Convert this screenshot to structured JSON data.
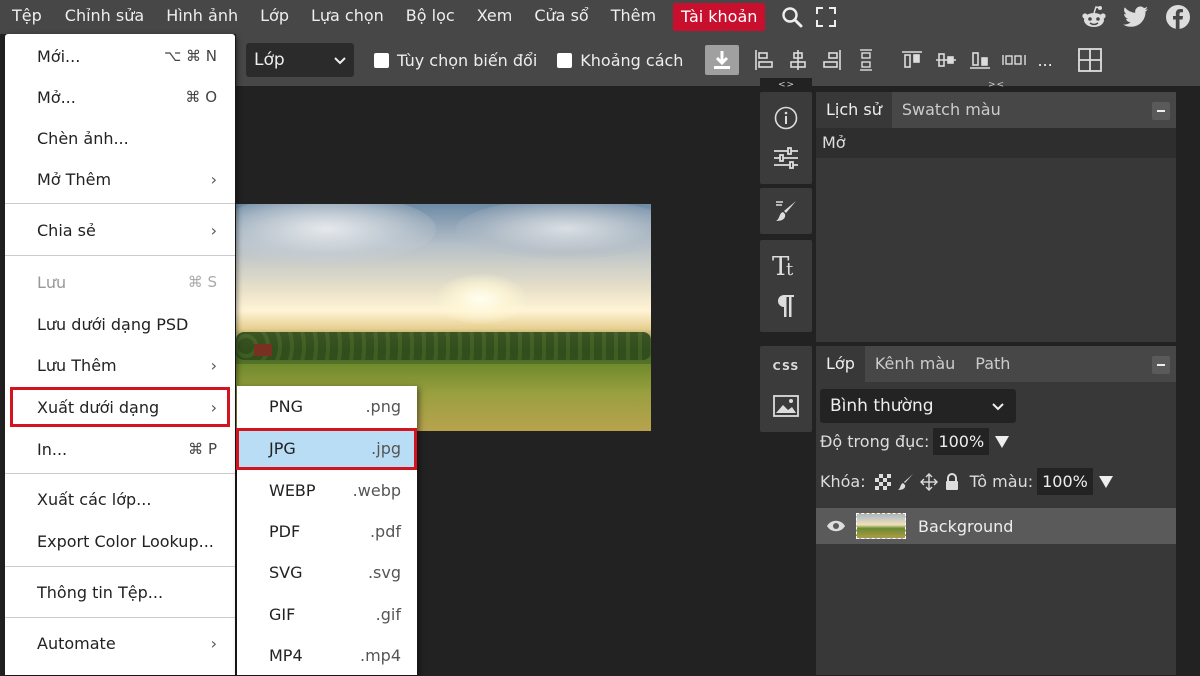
{
  "menubar": {
    "items": [
      "Tệp",
      "Chỉnh sửa",
      "Hình ảnh",
      "Lớp",
      "Lựa chọn",
      "Bộ lọc",
      "Xem",
      "Cửa sổ",
      "Thêm"
    ],
    "account": "Tài khoản",
    "account_color": "#c8102e",
    "icons": [
      "search-icon",
      "fullscreen-icon"
    ],
    "social_icons": [
      "reddit-icon",
      "twitter-icon",
      "facebook-icon"
    ]
  },
  "toolbar": {
    "layer_select": "Lớp",
    "transform_option": "Tùy chọn biến đổi",
    "spacing_option": "Khoảng cách",
    "more": "..."
  },
  "file_menu": {
    "items": [
      {
        "label": "Mới...",
        "shortcut": "⌥ ⌘ N"
      },
      {
        "label": "Mở...",
        "shortcut": "⌘ O"
      },
      {
        "label": "Chèn ảnh...",
        "shortcut": ""
      },
      {
        "label": "Mở Thêm",
        "shortcut": "›"
      },
      {
        "label": "Chia sẻ",
        "shortcut": "›"
      },
      {
        "label": "Lưu",
        "shortcut": "⌘ S",
        "disabled": true
      },
      {
        "label": "Lưu dưới dạng PSD",
        "shortcut": ""
      },
      {
        "label": "Lưu Thêm",
        "shortcut": "›"
      },
      {
        "label": "Xuất dưới dạng",
        "shortcut": "›"
      },
      {
        "label": "In...",
        "shortcut": "⌘ P"
      },
      {
        "label": "Xuất các lớp...",
        "shortcut": ""
      },
      {
        "label": "Export Color Lookup...",
        "shortcut": ""
      },
      {
        "label": "Thông tin Tệp...",
        "shortcut": ""
      },
      {
        "label": "Automate",
        "shortcut": "›"
      }
    ]
  },
  "export_submenu": {
    "items": [
      {
        "format": "PNG",
        "ext": ".png"
      },
      {
        "format": "JPG",
        "ext": ".jpg",
        "selected": true
      },
      {
        "format": "WEBP",
        "ext": ".webp"
      },
      {
        "format": "PDF",
        "ext": ".pdf"
      },
      {
        "format": "SVG",
        "ext": ".svg"
      },
      {
        "format": "GIF",
        "ext": ".gif"
      },
      {
        "format": "MP4",
        "ext": ".mp4"
      }
    ],
    "highlight_color": "#b9ddf5"
  },
  "side_strip": {
    "collapse_left": "<>",
    "collapse_right": "><",
    "css_label": "CSS"
  },
  "history_panel": {
    "tabs": [
      "Lịch sử",
      "Swatch màu"
    ],
    "entries": [
      "Mở"
    ]
  },
  "layers_panel": {
    "tabs": [
      "Lớp",
      "Kênh màu",
      "Path"
    ],
    "blend_mode": "Bình thường",
    "opacity_label": "Độ trong đục:",
    "opacity_value": "100%",
    "lock_label": "Khóa:",
    "fill_label": "Tô màu:",
    "fill_value": "100%",
    "layers": [
      "Background"
    ]
  },
  "annotation_color": "#d2141e"
}
